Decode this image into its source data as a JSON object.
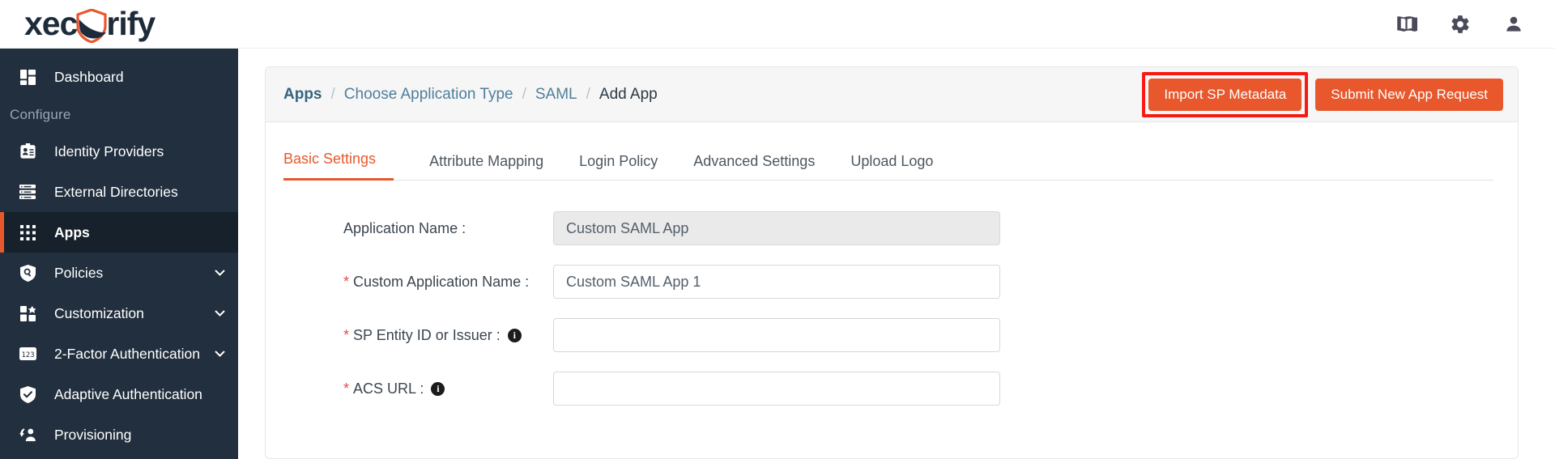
{
  "brand": {
    "name_part1": "xec",
    "name_part2": "rify",
    "logo_icon": "shield-icon",
    "accent_color": "#e8582c",
    "text_color": "#1d2b3a"
  },
  "header": {
    "icons": [
      {
        "name": "documentation-icon",
        "glyph": "book"
      },
      {
        "name": "settings-icon",
        "glyph": "gear"
      },
      {
        "name": "user-account-icon",
        "glyph": "person"
      }
    ]
  },
  "sidebar": {
    "background_color": "#222f3e",
    "active_accent_color": "#e8582c",
    "section_label": "Configure",
    "items": [
      {
        "label": "Dashboard",
        "icon": "dashboard-grid-icon",
        "active": false,
        "expandable": false
      },
      {
        "label": "Identity Providers",
        "icon": "id-badge-icon",
        "active": false,
        "expandable": false
      },
      {
        "label": "External Directories",
        "icon": "directory-list-icon",
        "active": false,
        "expandable": false
      },
      {
        "label": "Apps",
        "icon": "apps-grid-icon",
        "active": true,
        "expandable": false
      },
      {
        "label": "Policies",
        "icon": "shield-search-icon",
        "active": false,
        "expandable": true
      },
      {
        "label": "Customization",
        "icon": "customization-icon",
        "active": false,
        "expandable": true
      },
      {
        "label": "2-Factor Authentication",
        "icon": "numeric-123-icon",
        "active": false,
        "expandable": true
      },
      {
        "label": "Adaptive Authentication",
        "icon": "shield-check-icon",
        "active": false,
        "expandable": false
      },
      {
        "label": "Provisioning",
        "icon": "provisioning-user-icon",
        "active": false,
        "expandable": false
      }
    ]
  },
  "breadcrumb": {
    "items": [
      {
        "label": "Apps",
        "style": "link-strong"
      },
      {
        "label": "Choose Application Type",
        "style": "link"
      },
      {
        "label": "SAML",
        "style": "link"
      },
      {
        "label": "Add App",
        "style": "current"
      }
    ],
    "separator": "/"
  },
  "actions": {
    "import_sp_metadata": "Import SP Metadata",
    "submit_new_app_request": "Submit New App Request",
    "highlight_color": "#f71a13",
    "highlighted_button": "import_sp_metadata"
  },
  "tabs": [
    {
      "label": "Basic Settings",
      "active": true
    },
    {
      "label": "Attribute Mapping",
      "active": false
    },
    {
      "label": "Login Policy",
      "active": false
    },
    {
      "label": "Advanced Settings",
      "active": false
    },
    {
      "label": "Upload Logo",
      "active": false
    }
  ],
  "form": {
    "fields": [
      {
        "label": "Application Name :",
        "required": false,
        "info": false,
        "value": "Custom SAML App",
        "placeholder": "",
        "readonly": true,
        "name": "application-name"
      },
      {
        "label": "Custom Application Name :",
        "required": true,
        "info": false,
        "value": "Custom SAML App 1",
        "placeholder": "",
        "readonly": false,
        "name": "custom-application-name"
      },
      {
        "label": "SP Entity ID or Issuer :",
        "required": true,
        "info": true,
        "value": "",
        "placeholder": "",
        "readonly": false,
        "name": "sp-entity-id"
      },
      {
        "label": "ACS URL :",
        "required": true,
        "info": true,
        "value": "",
        "placeholder": "",
        "readonly": false,
        "name": "acs-url"
      }
    ],
    "required_marker": "*",
    "info_glyph": "i"
  }
}
